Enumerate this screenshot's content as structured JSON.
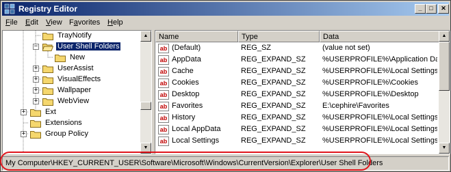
{
  "window": {
    "title": "Registry Editor",
    "icon": "registry-editor-icon"
  },
  "menubar": [
    {
      "underline": "F",
      "rest": "ile"
    },
    {
      "underline": "E",
      "rest": "dit"
    },
    {
      "underline": "V",
      "rest": "iew"
    },
    {
      "underline": "",
      "pre": "F",
      "underline2": "a",
      "rest": "vorites"
    },
    {
      "underline": "H",
      "rest": "elp"
    }
  ],
  "tree": {
    "nodes": [
      {
        "label": "TrayNotify",
        "expander": "",
        "selected": false
      },
      {
        "label": "User Shell Folders",
        "expander": "−",
        "selected": true
      },
      {
        "label": "New",
        "expander": "",
        "selected": false
      },
      {
        "label": "UserAssist",
        "expander": "+",
        "selected": false
      },
      {
        "label": "VisualEffects",
        "expander": "+",
        "selected": false
      },
      {
        "label": "Wallpaper",
        "expander": "+",
        "selected": false
      },
      {
        "label": "WebView",
        "expander": "+",
        "selected": false
      },
      {
        "label": "Ext",
        "expander": "+",
        "selected": false
      },
      {
        "label": "Extensions",
        "expander": "",
        "selected": false
      },
      {
        "label": "Group Policy",
        "expander": "+",
        "selected": false
      }
    ]
  },
  "list": {
    "columns": [
      "Name",
      "Type",
      "Data"
    ],
    "rows": [
      {
        "name": "(Default)",
        "type": "REG_SZ",
        "data": "(value not set)"
      },
      {
        "name": "AppData",
        "type": "REG_EXPAND_SZ",
        "data": "%USERPROFILE%\\Application Data"
      },
      {
        "name": "Cache",
        "type": "REG_EXPAND_SZ",
        "data": "%USERPROFILE%\\Local Settings\\Tempo"
      },
      {
        "name": "Cookies",
        "type": "REG_EXPAND_SZ",
        "data": "%USERPROFILE%\\Cookies"
      },
      {
        "name": "Desktop",
        "type": "REG_EXPAND_SZ",
        "data": "%USERPROFILE%\\Desktop"
      },
      {
        "name": "Favorites",
        "type": "REG_EXPAND_SZ",
        "data": "E:\\cephire\\Favorites"
      },
      {
        "name": "History",
        "type": "REG_EXPAND_SZ",
        "data": "%USERPROFILE%\\Local Settings\\History"
      },
      {
        "name": "Local AppData",
        "type": "REG_EXPAND_SZ",
        "data": "%USERPROFILE%\\Local Settings\\Appl"
      },
      {
        "name": "Local Settings",
        "type": "REG_EXPAND_SZ",
        "data": "%USERPROFILE%\\Local Settings"
      }
    ],
    "value_icon_text": "ab"
  },
  "statusbar": {
    "path": "My Computer\\HKEY_CURRENT_USER\\Software\\Microsoft\\Windows\\CurrentVersion\\Explorer\\User Shell Folders"
  },
  "colors": {
    "title_gradient_start": "#0a246a",
    "title_gradient_end": "#a6caf0",
    "selection": "#0a246a",
    "highlight_ring": "#e0141b"
  }
}
